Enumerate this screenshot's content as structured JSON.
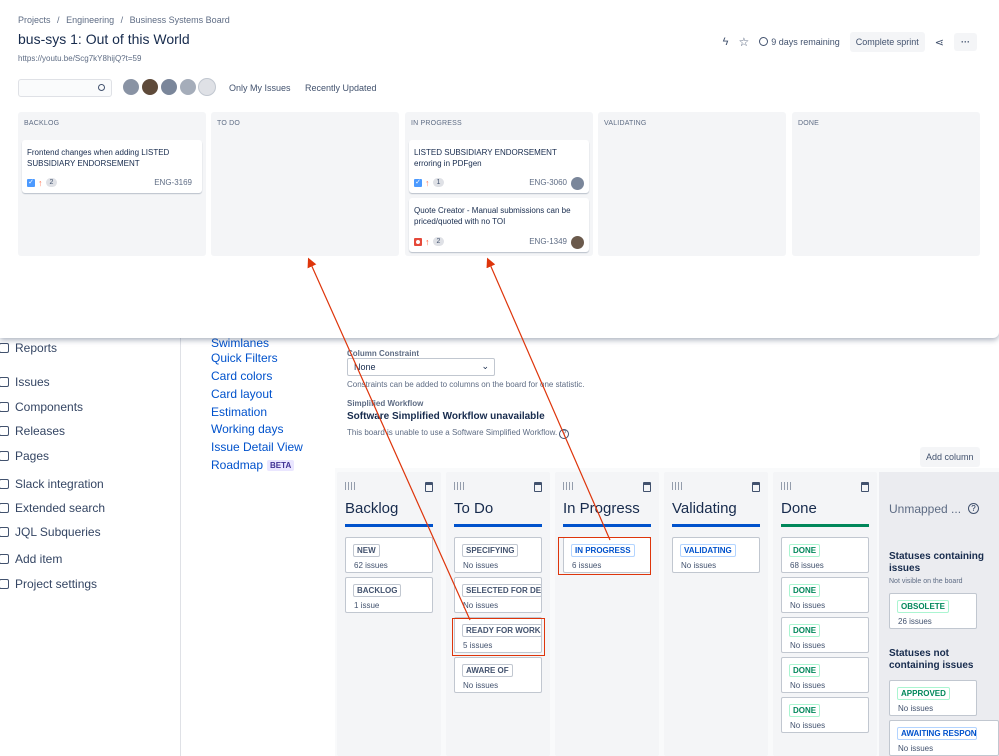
{
  "overlay": {
    "breadcrumbs": [
      "Projects",
      "/",
      "Engineering",
      "/",
      "Business Systems Board"
    ],
    "title": "bus-sys 1: Out of this World",
    "link": "https://youtu.be/Scg7kY8hijQ?t=59",
    "days_remaining": "9 days remaining",
    "complete_sprint": "Complete sprint",
    "filters": {
      "only_my_issues": "Only My Issues",
      "recently_updated": "Recently Updated"
    },
    "columns": [
      {
        "label": "BACKLOG"
      },
      {
        "label": "TO DO"
      },
      {
        "label": "IN PROGRESS"
      },
      {
        "label": "VALIDATING"
      },
      {
        "label": "DONE"
      }
    ],
    "cards": [
      {
        "title": "Frontend changes when adding LISTED SUBSIDIARY ENDORSEMENT",
        "count": "2",
        "key": "ENG-3169"
      },
      {
        "title": "LISTED SUBSIDIARY ENDORSEMENT erroring in PDFgen",
        "count": "1",
        "key": "ENG-3060"
      },
      {
        "title": "Quote Creator - Manual submissions can be priced/quoted with no TOI",
        "count": "2",
        "key": "ENG-1349"
      }
    ]
  },
  "sidebar": {
    "items": [
      "Reports",
      "Issues",
      "Components",
      "Releases",
      "Pages",
      "Slack integration",
      "Extended search",
      "JQL Subqueries",
      "Add item",
      "Project settings"
    ]
  },
  "config_nav": {
    "items": [
      "Swimlanes",
      "Quick Filters",
      "Card colors",
      "Card layout",
      "Estimation",
      "Working days",
      "Issue Detail View",
      "Roadmap"
    ],
    "beta": "BETA"
  },
  "config": {
    "column_constraint_label": "Column Constraint",
    "constraint_value": "None",
    "constraint_help": "Constraints can be added to columns on the board for one statistic.",
    "simplified_label": "Simplified Workflow",
    "simplified_title": "Software Simplified Workflow unavailable",
    "simplified_help": "This board is unable to use a Software Simplified Workflow.",
    "add_column": "Add column"
  },
  "columns_cfg": [
    {
      "title": "Backlog",
      "statuses": [
        {
          "name": "NEW",
          "count": "62 issues"
        },
        {
          "name": "BACKLOG",
          "count": "1 issue"
        }
      ]
    },
    {
      "title": "To Do",
      "statuses": [
        {
          "name": "SPECIFYING",
          "count": "No issues"
        },
        {
          "name": "SELECTED FOR DEV...",
          "count": "No issues"
        },
        {
          "name": "READY FOR WORK",
          "count": "5 issues"
        },
        {
          "name": "AWARE OF",
          "count": "No issues"
        }
      ]
    },
    {
      "title": "In Progress",
      "statuses": [
        {
          "name": "IN PROGRESS",
          "count": "6 issues"
        }
      ]
    },
    {
      "title": "Validating",
      "statuses": [
        {
          "name": "VALIDATING",
          "count": "No issues"
        }
      ]
    },
    {
      "title": "Done",
      "statuses": [
        {
          "name": "DONE",
          "count": "68 issues"
        },
        {
          "name": "DONE",
          "count": "No issues"
        },
        {
          "name": "DONE",
          "count": "No issues"
        },
        {
          "name": "DONE",
          "count": "No issues"
        },
        {
          "name": "DONE",
          "count": "No issues"
        }
      ]
    }
  ],
  "unmapped": {
    "title": "Unmapped ...",
    "containing_title": "Statuses containing issues",
    "containing_sub": "Not visible on the board",
    "obsolete": {
      "name": "OBSOLETE",
      "count": "26 issues"
    },
    "not_containing_title": "Statuses not containing issues",
    "approved": {
      "name": "APPROVED",
      "count": "No issues"
    },
    "awaiting": {
      "name": "AWAITING RESPONSE",
      "count": "No issues"
    }
  },
  "colors": {
    "accent": "#0052cc",
    "annotation": "#de350b",
    "done": "#00875a"
  }
}
